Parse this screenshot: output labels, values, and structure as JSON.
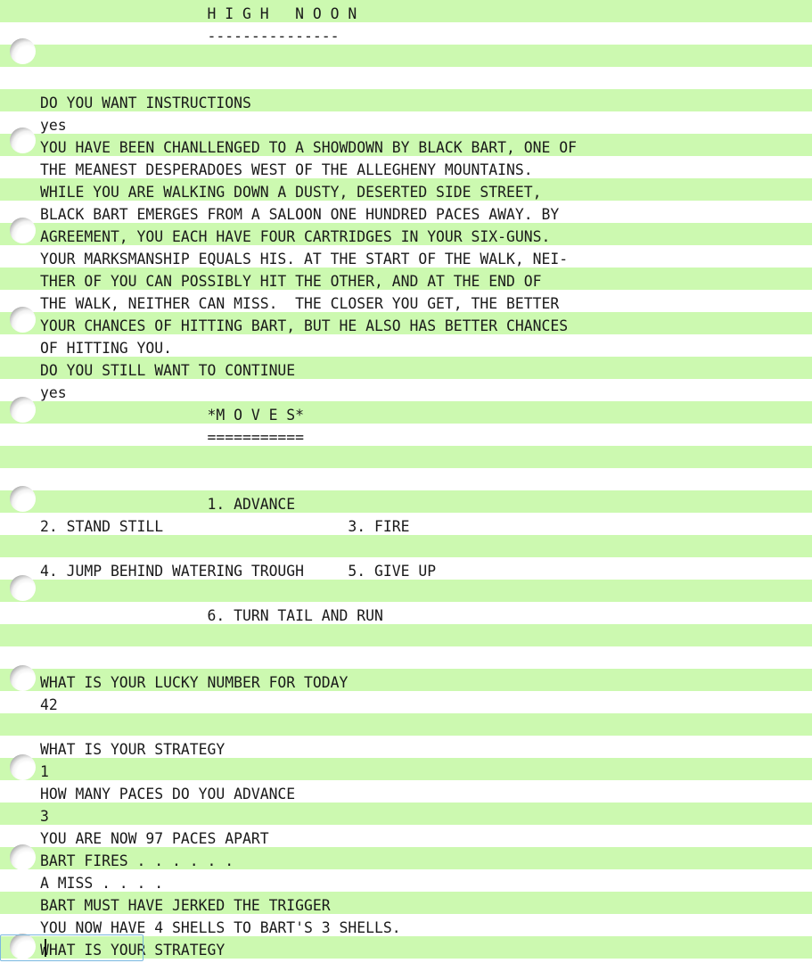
{
  "program": {
    "title_banner": "H I G H   N O O N",
    "title_rule": "---------------",
    "moves_banner": "*M O V E S*",
    "moves_rule": "===========",
    "menu": [
      {
        "number": "1.",
        "label": "ADVANCE"
      },
      {
        "number": "2.",
        "label": "STAND STILL"
      },
      {
        "number": "3.",
        "label": "FIRE"
      },
      {
        "number": "4.",
        "label": "JUMP BEHIND WATERING TROUGH"
      },
      {
        "number": "5.",
        "label": "GIVE UP"
      },
      {
        "number": "6.",
        "label": "TURN TAIL AND RUN"
      }
    ]
  },
  "transcript": [
    {
      "kind": "banner",
      "text": "                   H I G H   N O O N"
    },
    {
      "kind": "banner",
      "text": "                   ---------------"
    },
    {
      "kind": "blank",
      "text": " "
    },
    {
      "kind": "blank",
      "text": " "
    },
    {
      "kind": "prompt",
      "text": "DO YOU WANT INSTRUCTIONS"
    },
    {
      "kind": "answer",
      "text": "yes"
    },
    {
      "kind": "output",
      "text": "YOU HAVE BEEN CHANLLENGED TO A SHOWDOWN BY BLACK BART, ONE OF"
    },
    {
      "kind": "output",
      "text": "THE MEANEST DESPERADOES WEST OF THE ALLEGHENY MOUNTAINS."
    },
    {
      "kind": "output",
      "text": "WHILE YOU ARE WALKING DOWN A DUSTY, DESERTED SIDE STREET,"
    },
    {
      "kind": "output",
      "text": "BLACK BART EMERGES FROM A SALOON ONE HUNDRED PACES AWAY. BY"
    },
    {
      "kind": "output",
      "text": "AGREEMENT, YOU EACH HAVE FOUR CARTRIDGES IN YOUR SIX-GUNS."
    },
    {
      "kind": "output",
      "text": "YOUR MARKSMANSHIP EQUALS HIS. AT THE START OF THE WALK, NEI-"
    },
    {
      "kind": "output",
      "text": "THER OF YOU CAN POSSIBLY HIT THE OTHER, AND AT THE END OF"
    },
    {
      "kind": "output",
      "text": "THE WALK, NEITHER CAN MISS.  THE CLOSER YOU GET, THE BETTER"
    },
    {
      "kind": "output",
      "text": "YOUR CHANCES OF HITTING BART, BUT HE ALSO HAS BETTER CHANCES"
    },
    {
      "kind": "output",
      "text": "OF HITTING YOU."
    },
    {
      "kind": "prompt",
      "text": "DO YOU STILL WANT TO CONTINUE"
    },
    {
      "kind": "answer",
      "text": "yes"
    },
    {
      "kind": "banner",
      "text": "                   *M O V E S*"
    },
    {
      "kind": "banner",
      "text": "                   ==========="
    },
    {
      "kind": "blank",
      "text": " "
    },
    {
      "kind": "blank",
      "text": " "
    },
    {
      "kind": "menu",
      "text": "                   1. ADVANCE"
    },
    {
      "kind": "menu",
      "text": "2. STAND STILL                     3. FIRE"
    },
    {
      "kind": "blank",
      "text": " "
    },
    {
      "kind": "menu",
      "text": "4. JUMP BEHIND WATERING TROUGH     5. GIVE UP"
    },
    {
      "kind": "blank",
      "text": " "
    },
    {
      "kind": "menu",
      "text": "                   6. TURN TAIL AND RUN"
    },
    {
      "kind": "blank",
      "text": " "
    },
    {
      "kind": "blank",
      "text": " "
    },
    {
      "kind": "prompt",
      "text": "WHAT IS YOUR LUCKY NUMBER FOR TODAY"
    },
    {
      "kind": "answer",
      "text": "42"
    },
    {
      "kind": "blank",
      "text": " "
    },
    {
      "kind": "prompt",
      "text": "WHAT IS YOUR STRATEGY"
    },
    {
      "kind": "answer",
      "text": "1"
    },
    {
      "kind": "prompt",
      "text": "HOW MANY PACES DO YOU ADVANCE"
    },
    {
      "kind": "answer",
      "text": "3"
    },
    {
      "kind": "output",
      "text": "YOU ARE NOW 97 PACES APART"
    },
    {
      "kind": "output",
      "text": "BART FIRES . . . . . ."
    },
    {
      "kind": "output",
      "text": "A MISS . . . ."
    },
    {
      "kind": "output",
      "text": "BART MUST HAVE JERKED THE TRIGGER"
    },
    {
      "kind": "output",
      "text": "YOU NOW HAVE 4 SHELLS TO BART'S 3 SHELLS."
    },
    {
      "kind": "prompt",
      "text": "WHAT IS YOUR STRATEGY"
    }
  ],
  "game_state": {
    "lucky_number": "42",
    "strategy_chosen": "1",
    "paces_advanced": "3",
    "paces_apart": "97",
    "player_shells": "4",
    "bart_shells": "3",
    "last_result": "A MISS"
  },
  "input": {
    "value": "",
    "placeholder": ""
  },
  "paper": {
    "stripe_color": "#ccf9b0",
    "paper_color": "#ffffff",
    "text_color": "#1a1a1a",
    "input_border_color": "#7ab8e0",
    "hole_count": 11
  }
}
